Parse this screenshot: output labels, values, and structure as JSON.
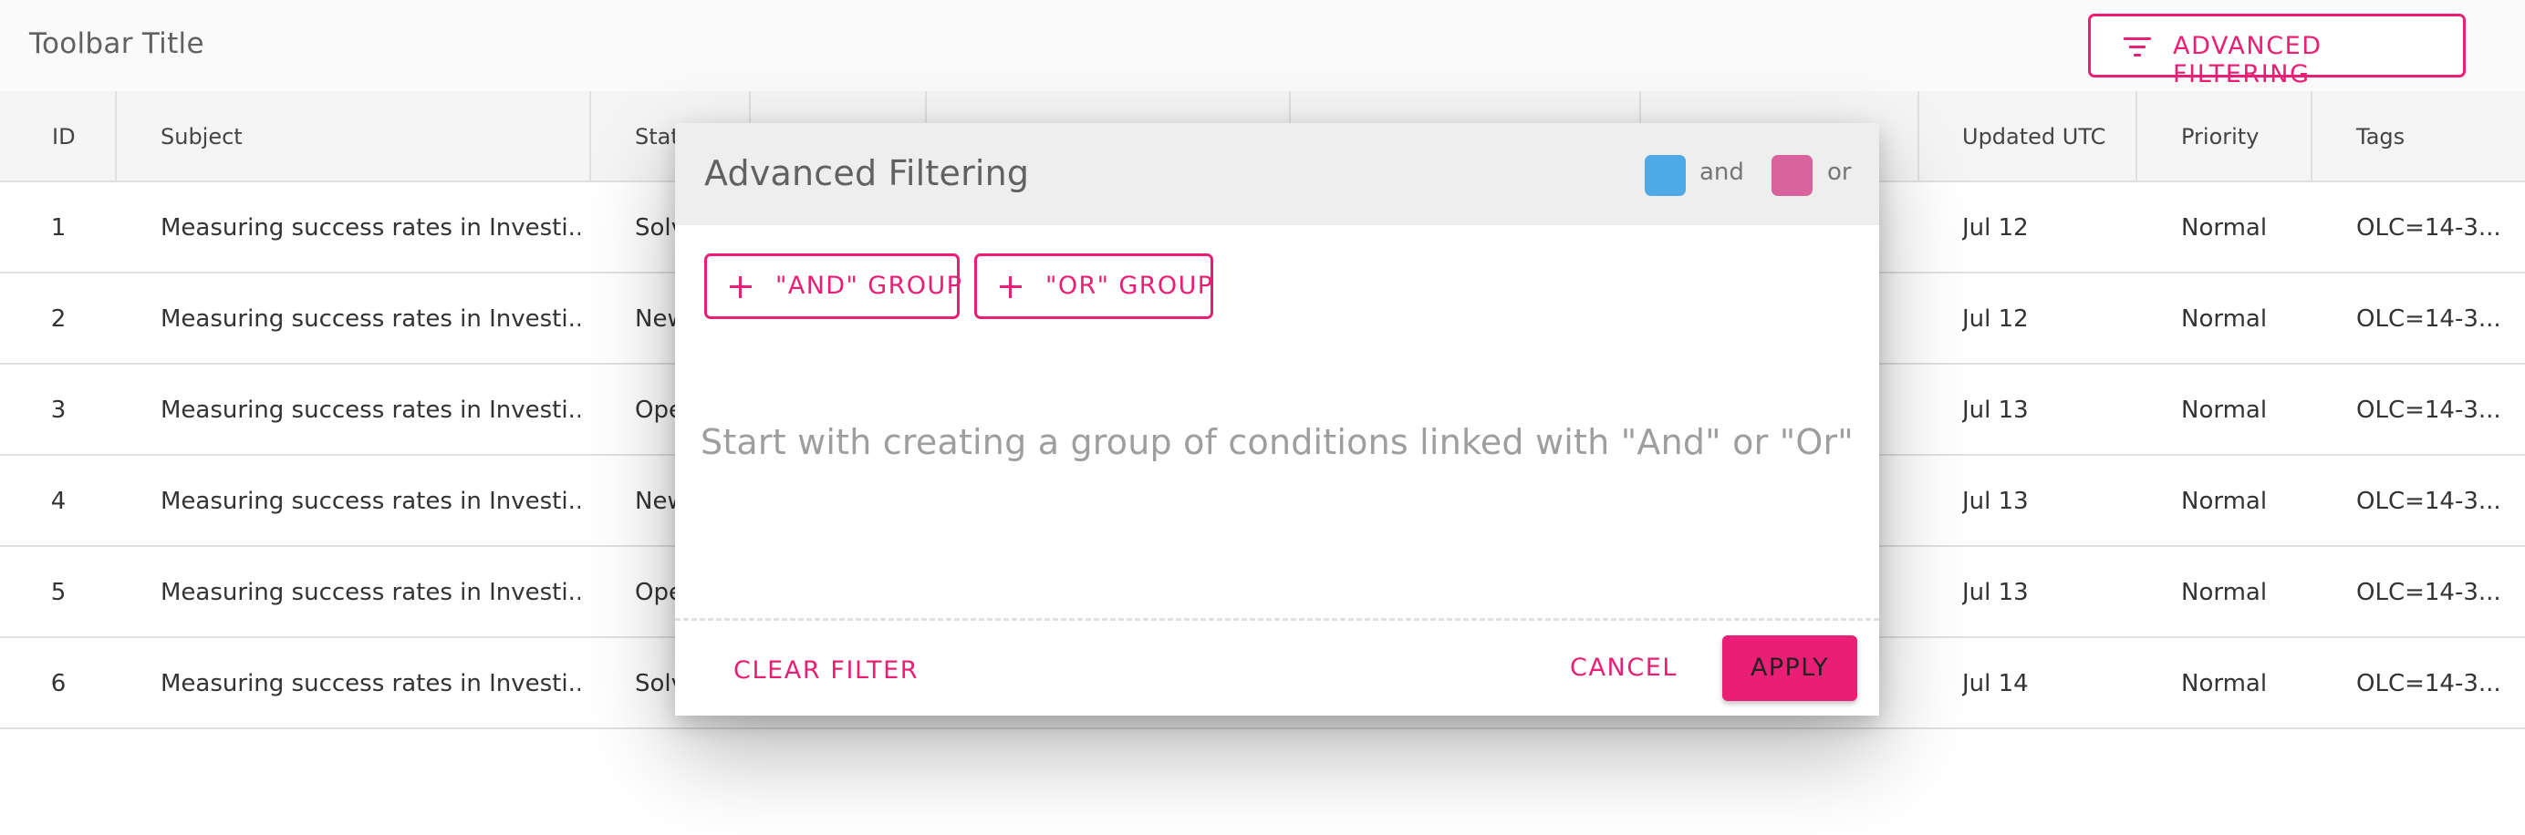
{
  "toolbar": {
    "title": "Toolbar Title",
    "advanced_filter_label": "ADVANCED FILTERING",
    "accent_color": "#e91e74"
  },
  "grid": {
    "columns": [
      "ID",
      "Subject",
      "Stat",
      "",
      "",
      "",
      "",
      "Updated UTC",
      "Priority",
      "Tags"
    ],
    "rows": [
      {
        "id": "1",
        "subject": "Measuring success rates in Investi...",
        "status": "Solv",
        "updated": "Jul 12",
        "priority": "Normal",
        "tags": "OLC=14-3..."
      },
      {
        "id": "2",
        "subject": "Measuring success rates in Investi...",
        "status": "New",
        "updated": "Jul 12",
        "priority": "Normal",
        "tags": "OLC=14-3..."
      },
      {
        "id": "3",
        "subject": "Measuring success rates in Investi...",
        "status": "Ope",
        "updated": "Jul 13",
        "priority": "Normal",
        "tags": "OLC=14-3..."
      },
      {
        "id": "4",
        "subject": "Measuring success rates in Investi...",
        "status": "New",
        "updated": "Jul 13",
        "priority": "Normal",
        "tags": "OLC=14-3..."
      },
      {
        "id": "5",
        "subject": "Measuring success rates in Investi...",
        "status": "Ope",
        "updated": "Jul 13",
        "priority": "Normal",
        "tags": "OLC=14-3..."
      },
      {
        "id": "6",
        "subject": "Measuring success rates in Investi...",
        "status": "Solv",
        "updated": "Jul 14",
        "priority": "Normal",
        "tags": "OLC=14-3..."
      }
    ]
  },
  "dialog": {
    "title": "Advanced Filtering",
    "legend": {
      "and_label": "and",
      "and_color": "#4ea9e6",
      "or_label": "or",
      "or_color": "#d9639c"
    },
    "and_group_label": "\"AND\" GROUP",
    "or_group_label": "\"OR\" GROUP",
    "empty_message": "Start with creating a group of conditions linked with \"And\" or \"Or\"",
    "clear_filter_label": "CLEAR FILTER",
    "cancel_label": "CANCEL",
    "apply_label": "APPLY"
  }
}
